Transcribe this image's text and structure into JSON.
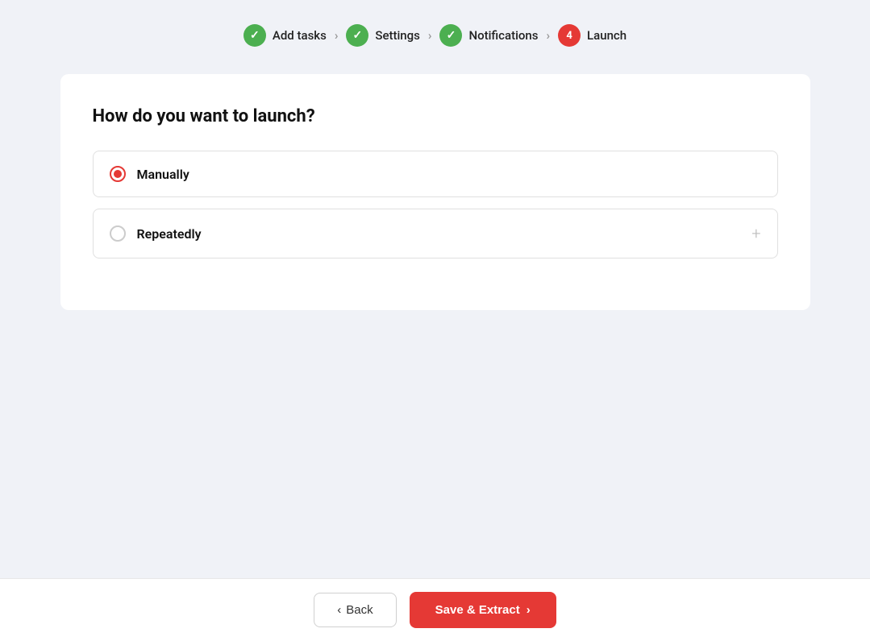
{
  "stepper": {
    "steps": [
      {
        "label": "Add tasks",
        "status": "done",
        "number": null
      },
      {
        "label": "Settings",
        "status": "done",
        "number": null
      },
      {
        "label": "Notifications",
        "status": "done",
        "number": null
      },
      {
        "label": "Launch",
        "status": "active",
        "number": "4"
      }
    ],
    "arrows": [
      "›",
      "›",
      "›"
    ]
  },
  "card": {
    "title": "How do you want to launch?",
    "options": [
      {
        "label": "Manually",
        "selected": true
      },
      {
        "label": "Repeatedly",
        "selected": false
      }
    ]
  },
  "footer": {
    "back_label": "Back",
    "save_label": "Save & Extract",
    "back_arrow": "‹",
    "save_arrow": "›"
  }
}
